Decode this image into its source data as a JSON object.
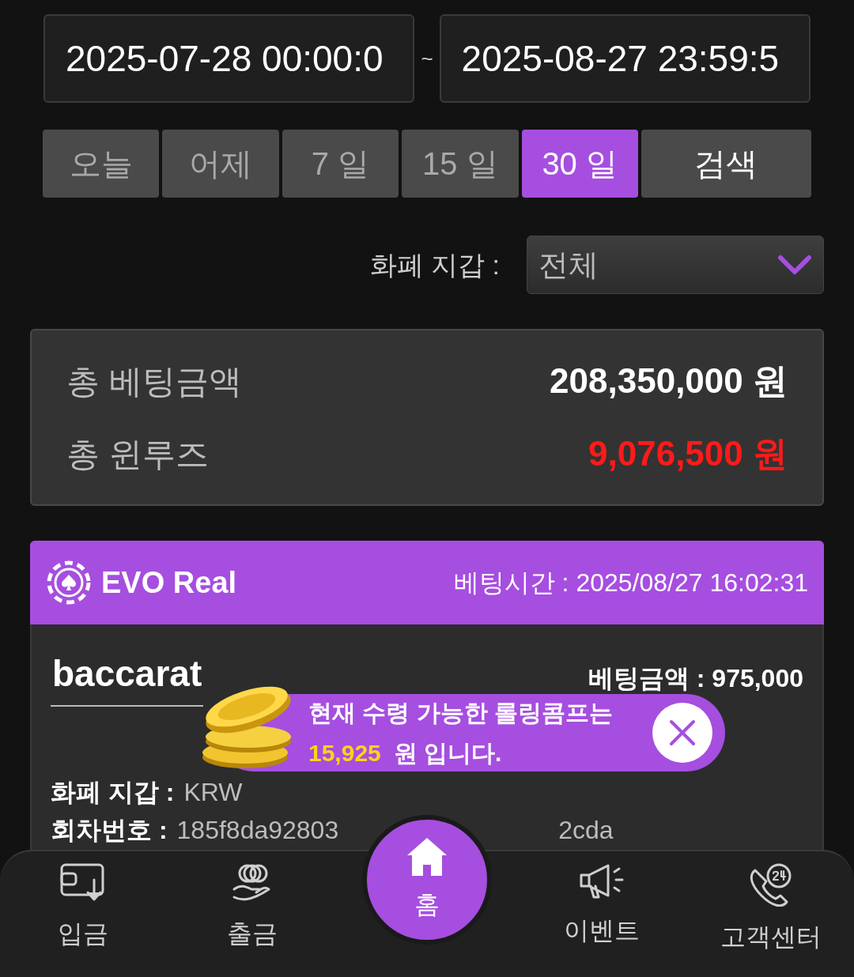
{
  "date_range": {
    "start": "2025-07-28 00:00:0",
    "separator": "~",
    "end": "2025-08-27 23:59:5"
  },
  "period_buttons": [
    {
      "label": "오늘",
      "selected": false
    },
    {
      "label": "어제",
      "selected": false
    },
    {
      "label": "7 일",
      "selected": false
    },
    {
      "label": "15 일",
      "selected": false
    },
    {
      "label": "30 일",
      "selected": true
    }
  ],
  "search_button": "검색",
  "currency_filter": {
    "label": "화폐 지갑 :",
    "value": "전체"
  },
  "summary": [
    {
      "label": "총 베팅금액",
      "value": "208,350,000 원",
      "kind": "normal"
    },
    {
      "label": "총 윈루즈",
      "value": "9,076,500 원",
      "kind": "negative"
    }
  ],
  "bet_card": {
    "provider": "EVO Real",
    "bet_time_label": "베팅시간 :",
    "bet_time": "2025/08/27 16:02:31",
    "game": "baccarat",
    "bet_amount_label": "베팅금액 :",
    "bet_amount": "975,000",
    "fields": [
      {
        "label": "화폐 지갑 :",
        "value": "KRW"
      },
      {
        "label": "회차번호 :",
        "value": "185f8da92803",
        "value_tail": "2cda"
      }
    ]
  },
  "popup": {
    "line1": "현재 수령 가능한 롤링콤프는",
    "amount": "15,925",
    "unit": "원 입니다."
  },
  "bottom_nav": [
    {
      "label": "입금",
      "kind": "deposit",
      "selected": false
    },
    {
      "label": "출금",
      "kind": "withdraw",
      "selected": false
    },
    {
      "label": "홈",
      "kind": "home",
      "selected": true
    },
    {
      "label": "이벤트",
      "kind": "event",
      "selected": false
    },
    {
      "label": "고객센터",
      "kind": "support",
      "selected": false
    }
  ]
}
